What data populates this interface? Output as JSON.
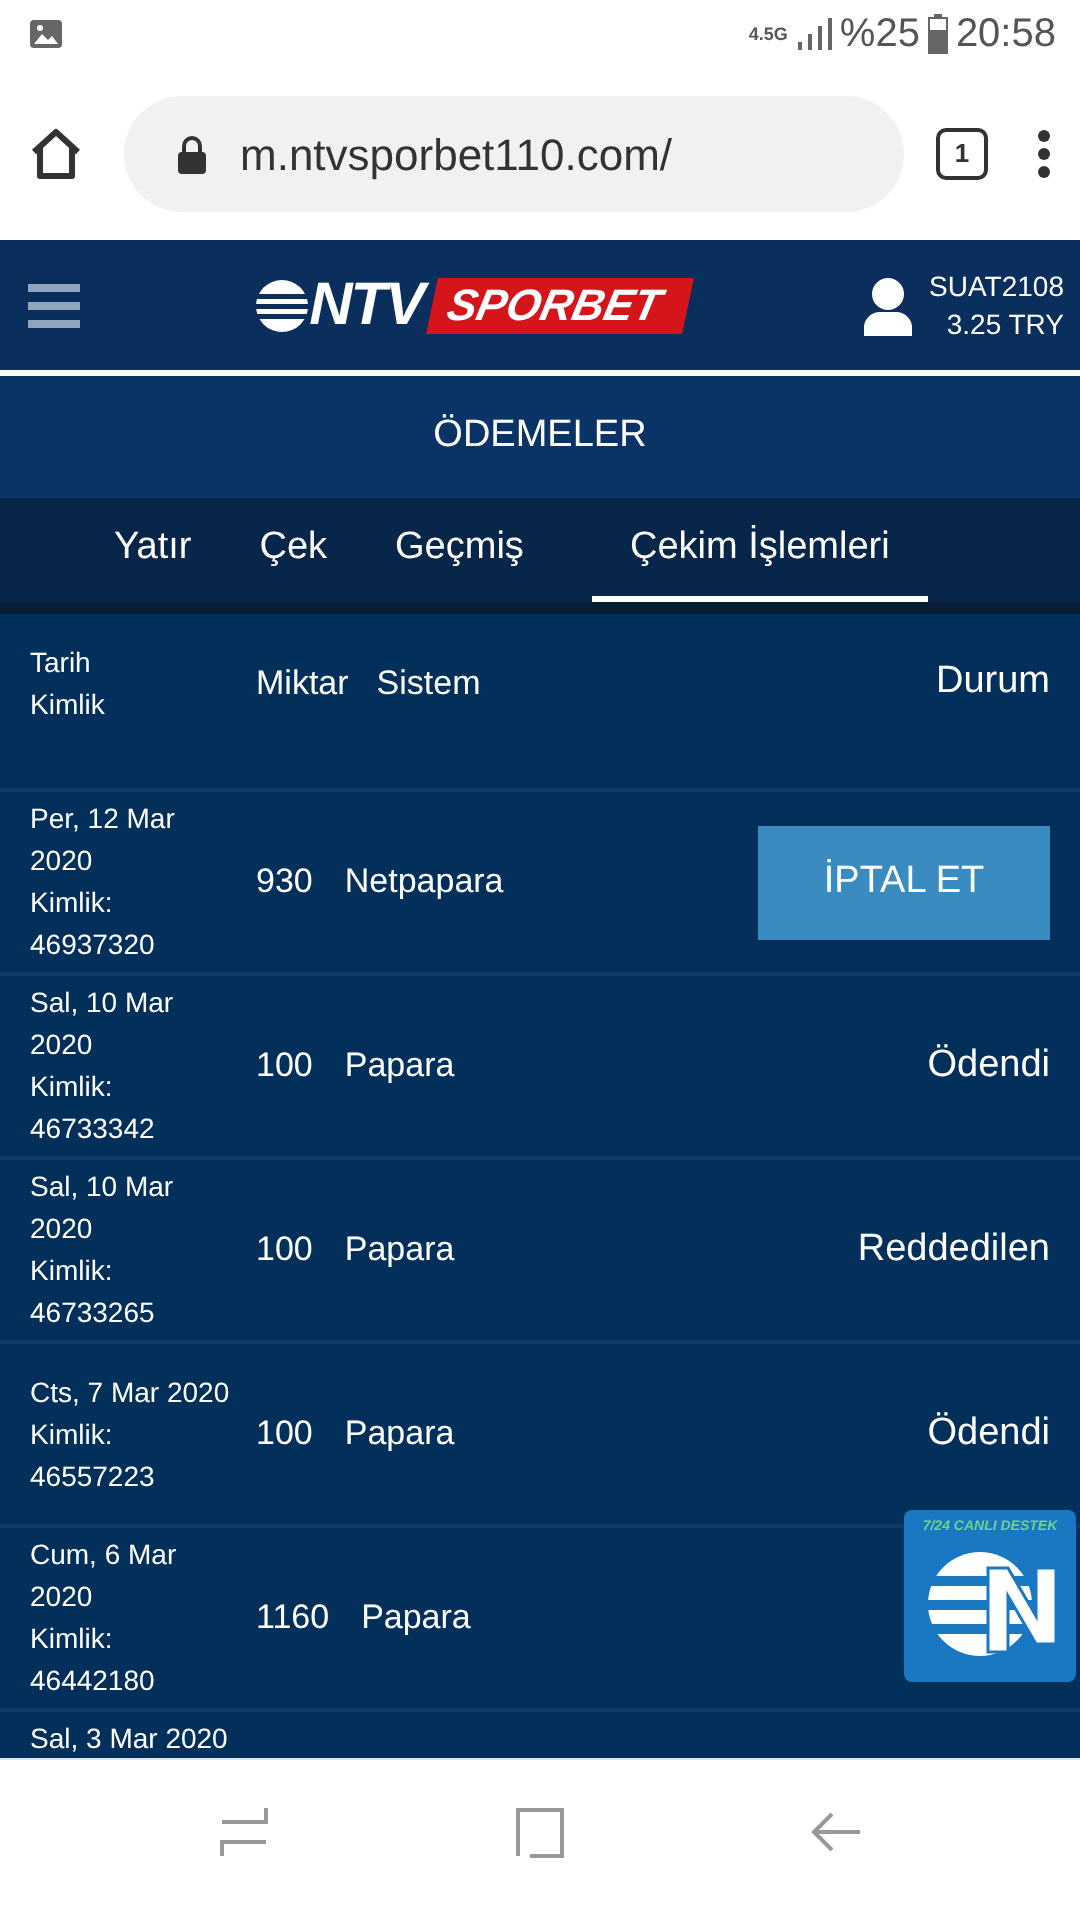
{
  "status_bar": {
    "network": "4.5G",
    "battery": "%25",
    "time": "20:58"
  },
  "browser": {
    "url": "m.ntvsporbet110.com/",
    "tab_count": "1"
  },
  "header": {
    "logo_left": "NTV",
    "logo_right": "SPORBET",
    "username": "SUAT2108",
    "balance": "3.25 TRY"
  },
  "page_title": "ÖDEMELER",
  "tabs": [
    {
      "label": "Yatır",
      "selected": false
    },
    {
      "label": "Çek",
      "selected": false
    },
    {
      "label": "Geçmiş",
      "selected": false
    },
    {
      "label": "Çekim İşlemleri",
      "selected": true
    }
  ],
  "table": {
    "header": {
      "date": "Tarih",
      "id": "Kimlik",
      "amount": "Miktar",
      "system": "Sistem",
      "status": "Durum"
    },
    "rows": [
      {
        "date": "Per, 12 Mar 2020",
        "id": "Kimlik: 46937320",
        "amount": "930",
        "system": "Netpapara",
        "status": {
          "kind": "button",
          "text": "İPTAL ET"
        }
      },
      {
        "date": "Sal, 10 Mar 2020",
        "id": "Kimlik: 46733342",
        "amount": "100",
        "system": "Papara",
        "status": {
          "kind": "text",
          "text": "Ödendi"
        }
      },
      {
        "date": "Sal, 10 Mar 2020",
        "id": "Kimlik: 46733265",
        "amount": "100",
        "system": "Papara",
        "status": {
          "kind": "text",
          "text": "Reddedilen"
        }
      },
      {
        "date": "Cts, 7 Mar 2020",
        "id": "Kimlik: 46557223",
        "amount": "100",
        "system": "Papara",
        "status": {
          "kind": "text",
          "text": "Ödendi"
        }
      },
      {
        "date": "Cum, 6 Mar 2020",
        "id": "Kimlik: 46442180",
        "amount": "1160",
        "system": "Papara",
        "status": {
          "kind": "none"
        }
      },
      {
        "date": "Sal, 3 Mar 2020"
      }
    ]
  },
  "live_support": {
    "label": "7/24 CANLI DESTEK"
  }
}
